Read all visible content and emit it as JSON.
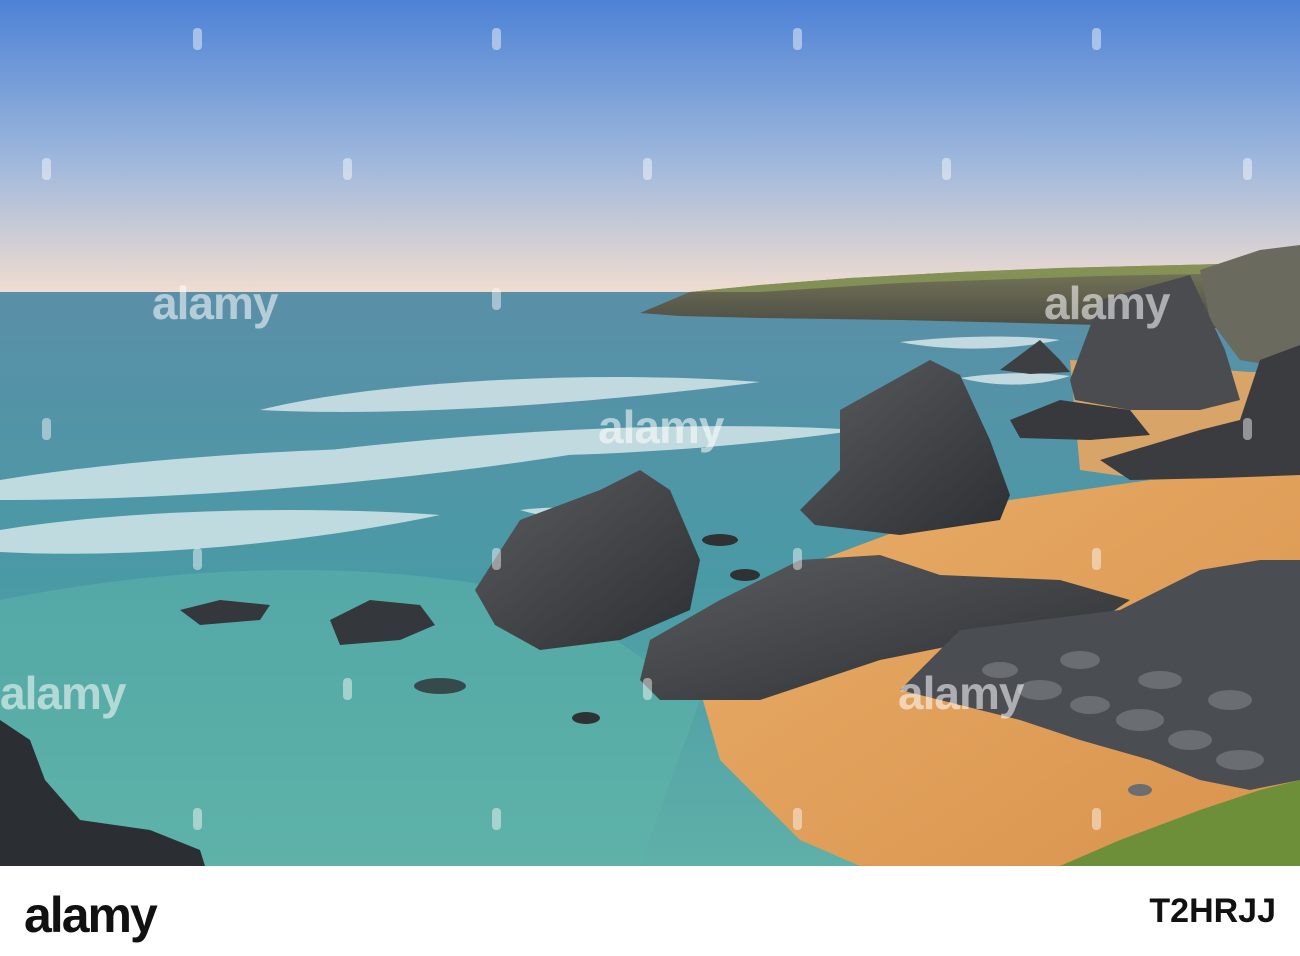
{
  "watermark": {
    "brand": "alamy"
  },
  "footer": {
    "brand": "alamy",
    "image_id": "T2HRJJ"
  },
  "colors": {
    "sky_top": "#4f85d8",
    "sky_horizon": "#f0dcd0",
    "sea": "#3e8fa0",
    "sand": "#e0a25e",
    "rock": "#3a3d42",
    "grass": "#6e8f3a"
  }
}
